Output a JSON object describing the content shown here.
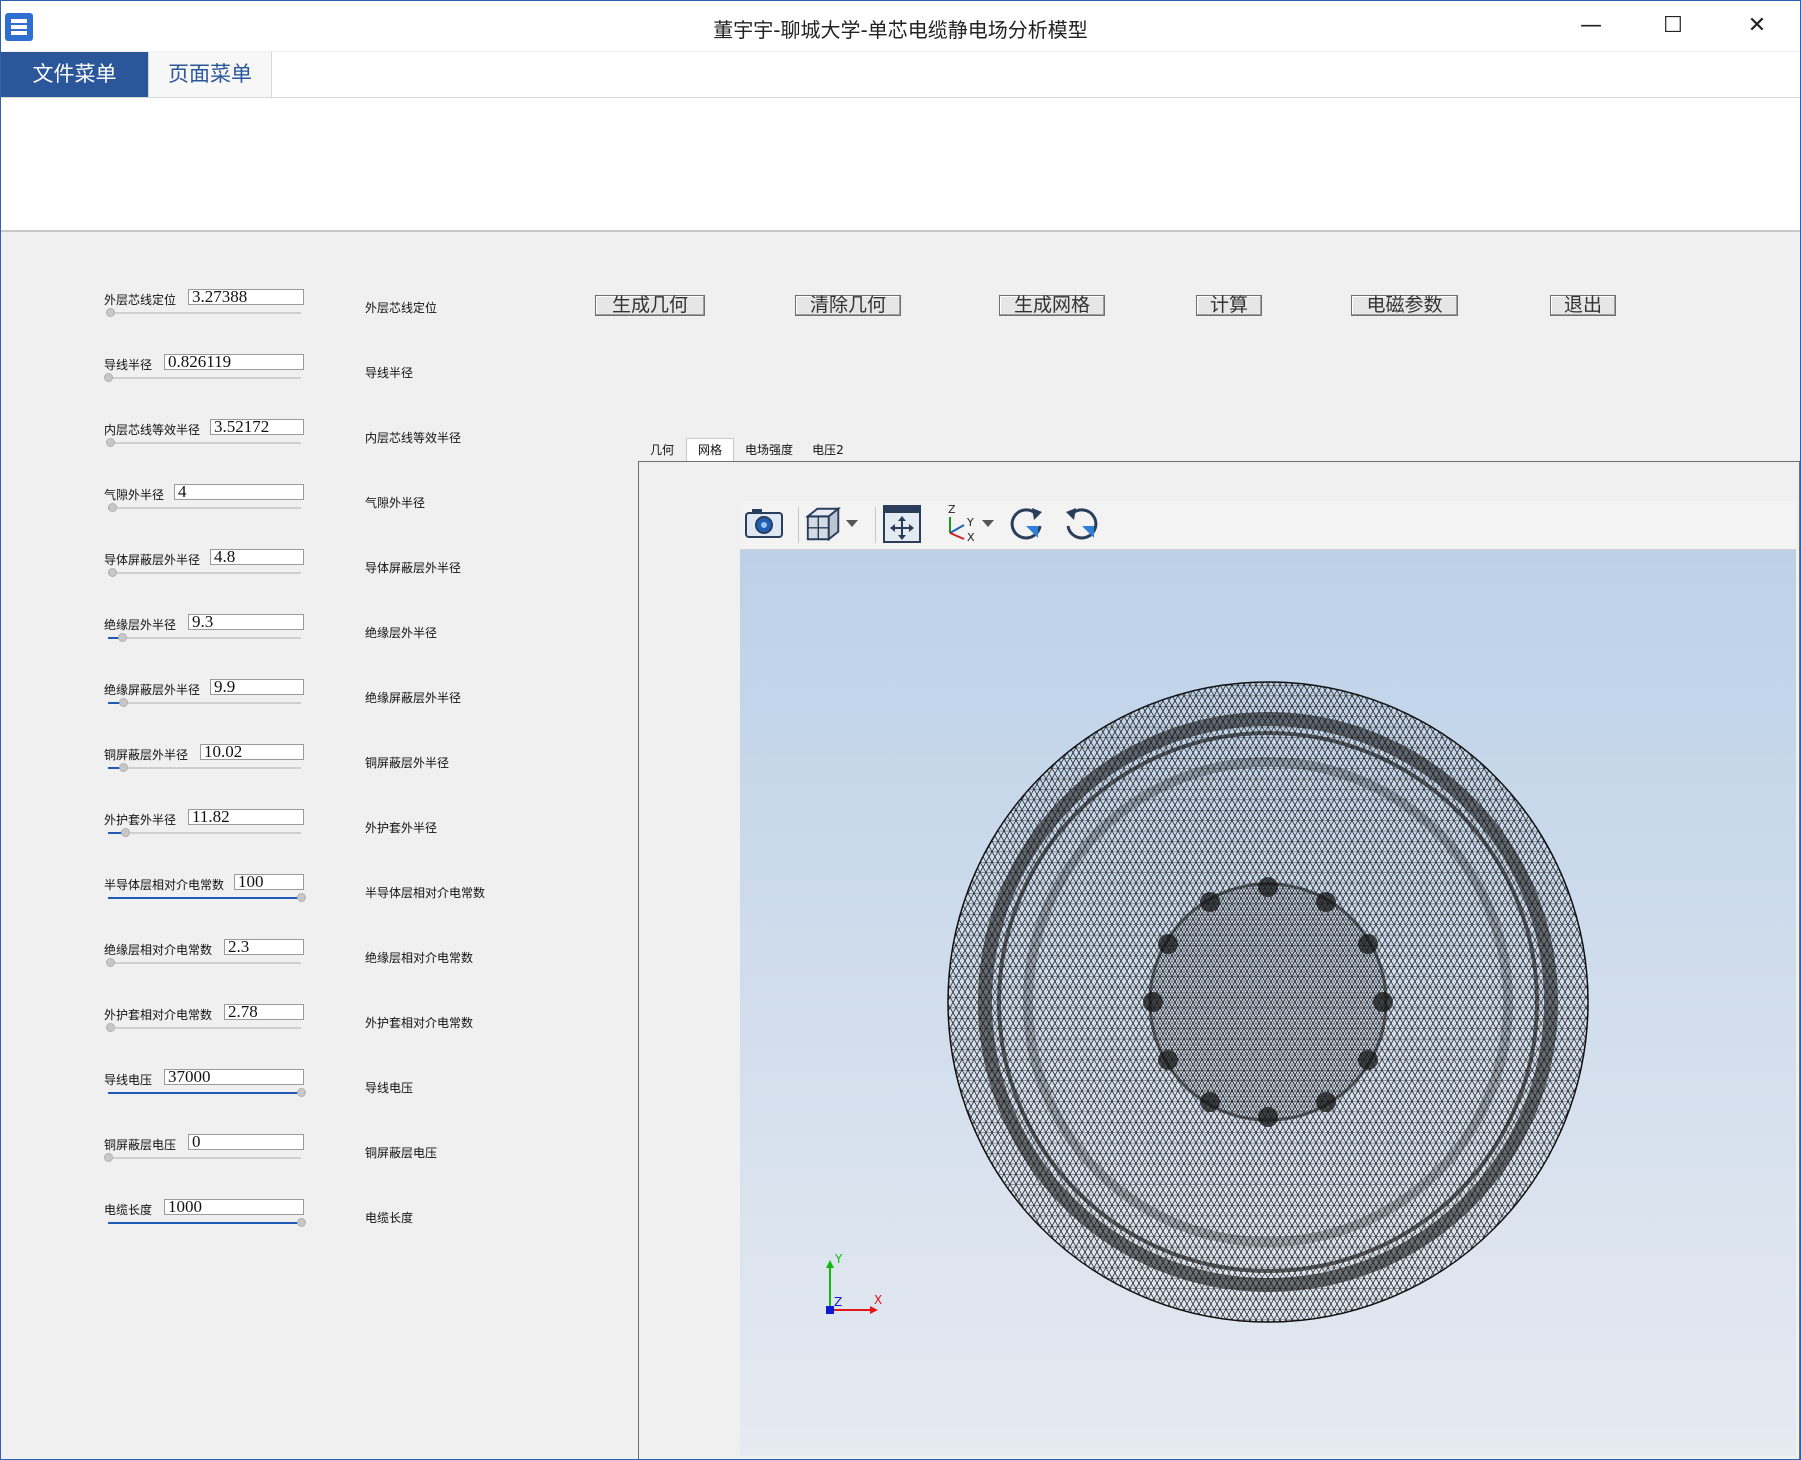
{
  "window": {
    "title": "董宇宇-聊城大学-单芯电缆静电场分析模型",
    "minimize": "—",
    "maximize": "☐",
    "close": "✕"
  },
  "ribbon": {
    "tabs": [
      {
        "label": "文件菜单",
        "active": true
      },
      {
        "label": "页面菜单",
        "active": false
      }
    ]
  },
  "params": [
    {
      "label": "外层芯线定位",
      "value": "3.27388",
      "slider": 0.01
    },
    {
      "label": "导线半径",
      "value": "0.826119",
      "slider": 0.0
    },
    {
      "label": "内层芯线等效半径",
      "value": "3.52172",
      "slider": 0.01
    },
    {
      "label": "气隙外半径",
      "value": "4",
      "slider": 0.02
    },
    {
      "label": "导体屏蔽层外半径",
      "value": "4.8",
      "slider": 0.02
    },
    {
      "label": "绝缘层外半径",
      "value": "9.3",
      "slider": 0.07
    },
    {
      "label": "绝缘屏蔽层外半径",
      "value": "9.9",
      "slider": 0.08
    },
    {
      "label": "铜屏蔽层外半径",
      "value": "10.02",
      "slider": 0.08
    },
    {
      "label": "外护套外半径",
      "value": "11.82",
      "slider": 0.09
    },
    {
      "label": "半导体层相对介电常数",
      "value": "100",
      "slider": 1.0
    },
    {
      "label": "绝缘层相对介电常数",
      "value": "2.3",
      "slider": 0.01
    },
    {
      "label": "外护套相对介电常数",
      "value": "2.78",
      "slider": 0.01
    },
    {
      "label": "导线电压",
      "value": "37000",
      "slider": 1.0
    },
    {
      "label": "铜屏蔽层电压",
      "value": "0",
      "slider": 0.0
    },
    {
      "label": "电缆长度",
      "value": "1000",
      "slider": 1.0
    }
  ],
  "actions": {
    "generate_geometry": "生成几何",
    "clear_geometry": "清除几何",
    "generate_mesh": "生成网格",
    "compute": "计算",
    "em_params": "电磁参数",
    "exit": "退出"
  },
  "view_tabs": [
    {
      "label": "几何",
      "active": false
    },
    {
      "label": "网格",
      "active": true
    },
    {
      "label": "电场强度",
      "active": false
    },
    {
      "label": "电压2",
      "active": false
    }
  ],
  "toolbar_icons": [
    "camera-icon",
    "cube-view-icon",
    "dropdown-arrow-icon",
    "fit-view-icon",
    "axis-orientation-icon",
    "dropdown-arrow-icon",
    "rotate-cw-icon",
    "rotate-ccw-icon"
  ],
  "triad": {
    "y": "Y",
    "z": "Z",
    "x": "X"
  },
  "colors": {
    "accent": "#2b579a",
    "titlebar_border": "#2b62b0",
    "slider_fill": "#1d5bb6",
    "viewport_top": "#bcd1e8",
    "viewport_bottom": "#e6eaf1"
  }
}
